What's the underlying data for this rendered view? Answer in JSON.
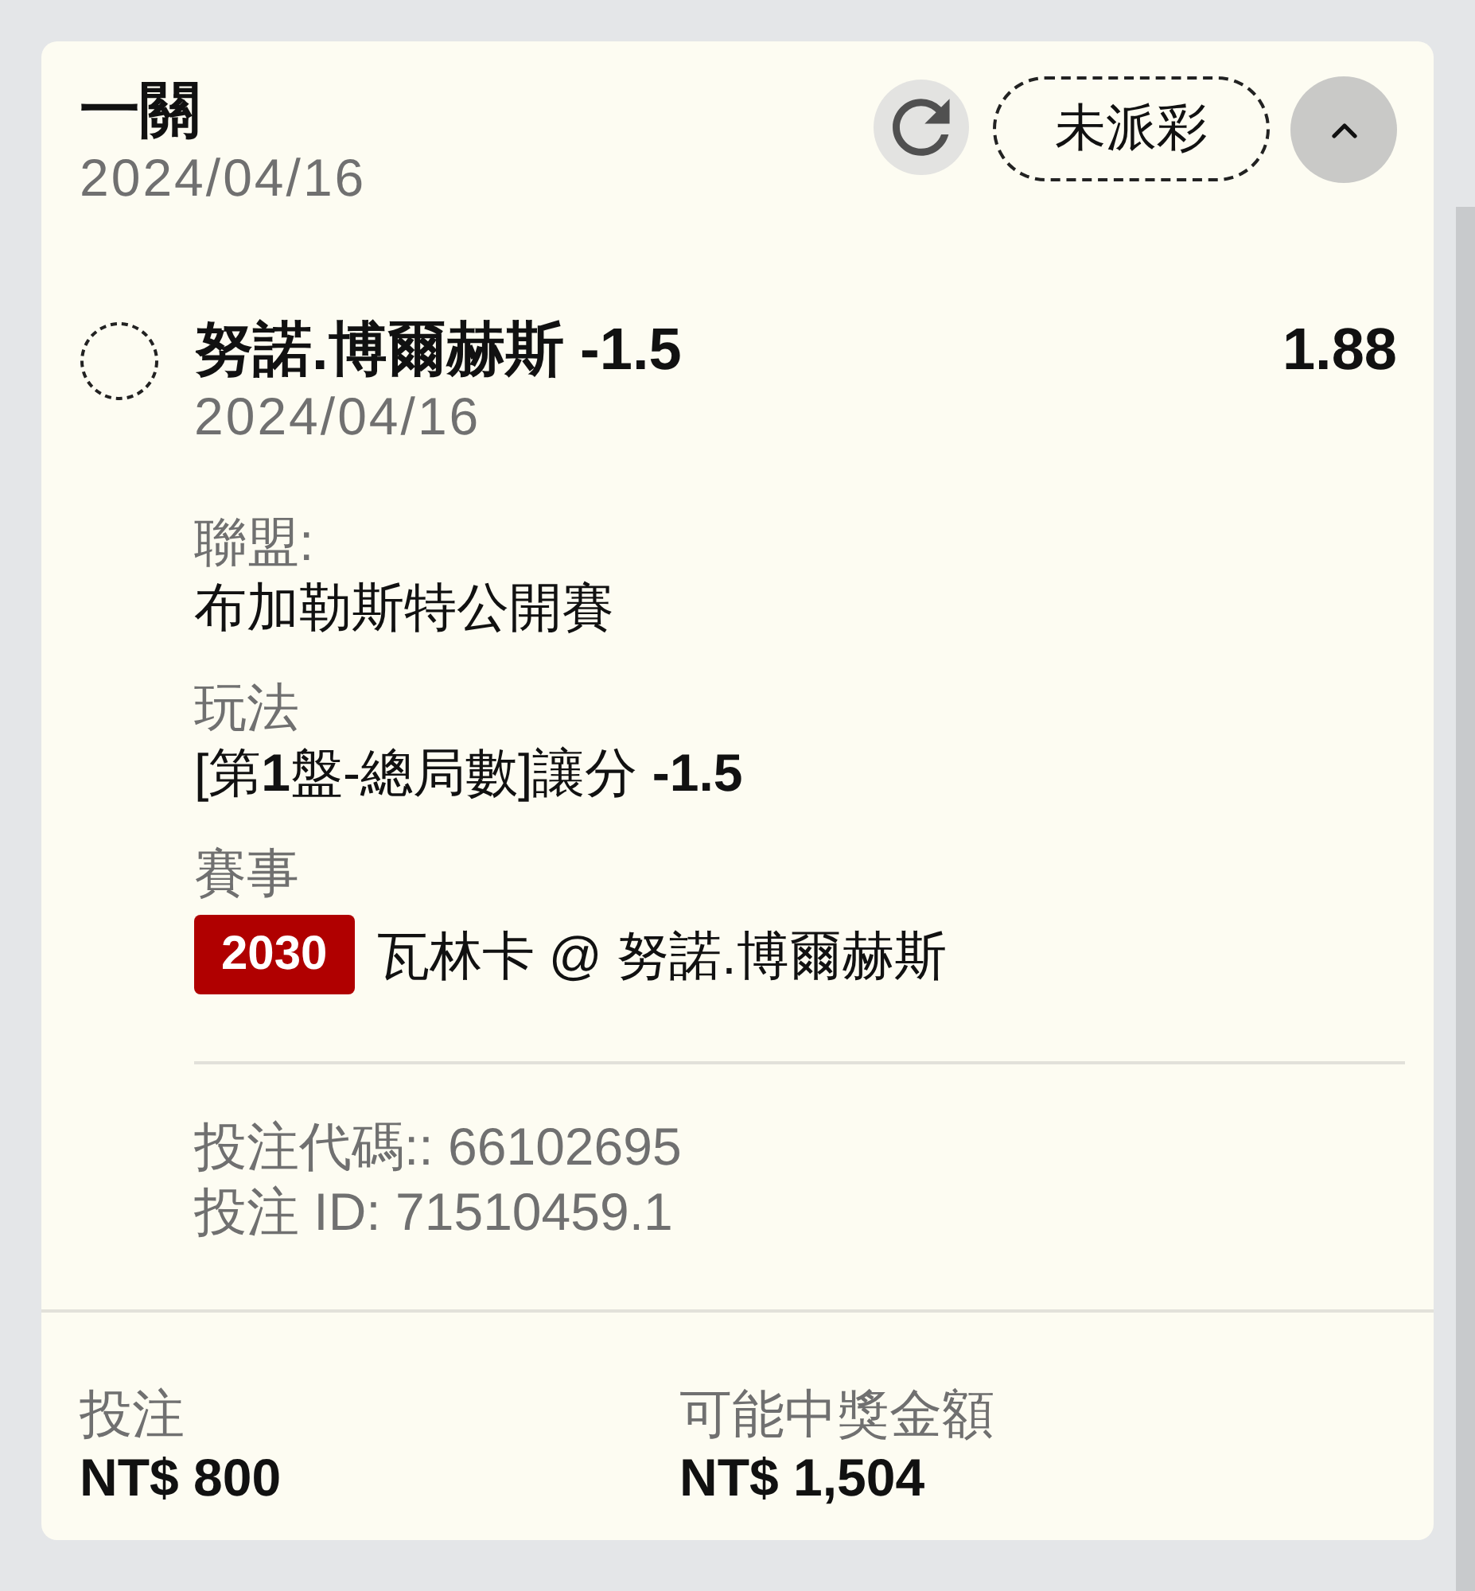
{
  "bet": {
    "title": "一關",
    "date": "2024/04/16",
    "status": "未派彩",
    "expanded": true
  },
  "selection": {
    "name": "努諾.博爾赫斯 -1.5",
    "odds": "1.88",
    "date": "2024/04/16"
  },
  "details": [
    {
      "kind": "text",
      "label": "聯盟:",
      "value": "布加勒斯特公開賽"
    },
    {
      "kind": "text",
      "label": "玩法",
      "value": "[第**1**盤-總局數]讓分 **-1.5**"
    },
    {
      "kind": "event",
      "label": "賽事",
      "code": "2030",
      "value": "瓦林卡 @ 努諾.博爾赫斯"
    }
  ],
  "references": [
    "投注代碼:: 66102695",
    "投注 ID: 71510459.1"
  ],
  "summary": [
    {
      "label": "投注",
      "amount": "NT$ 800"
    },
    {
      "label": "可能中獎金額",
      "amount": "NT$ 1,504"
    }
  ]
}
